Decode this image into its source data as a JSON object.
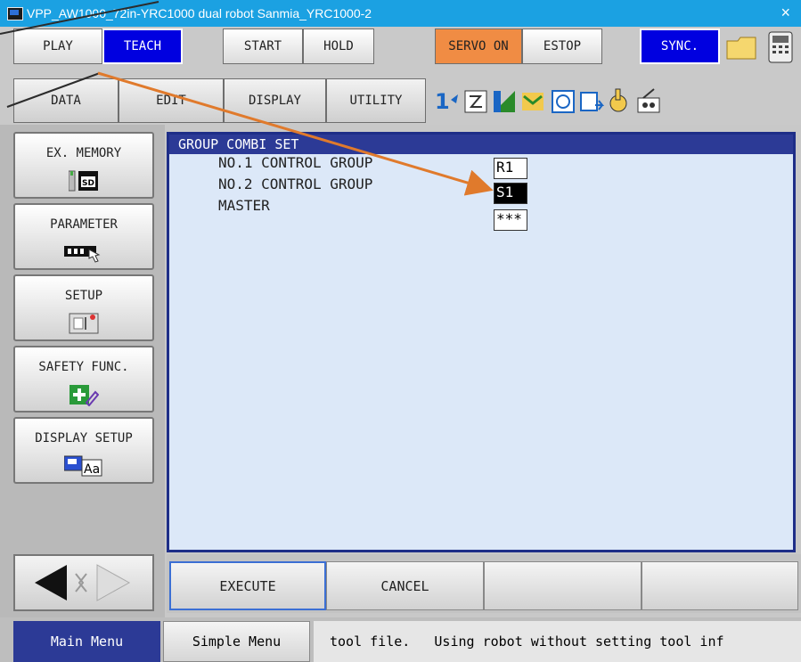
{
  "window": {
    "title": "VPP_AW1000_72in-YRC1000 dual robot Sanmia_YRC1000-2",
    "close": "×"
  },
  "top_buttons": {
    "play": "PLAY",
    "teach": "TEACH",
    "start": "START",
    "hold": "HOLD",
    "servo_on": "SERVO ON",
    "estop": "ESTOP",
    "sync": "SYNC."
  },
  "menu": {
    "data": "DATA",
    "edit": "EDIT",
    "display": "DISPLAY",
    "utility": "UTILITY"
  },
  "status_icons": [
    "coordinate-icon",
    "teach-lock-icon",
    "level-icon",
    "robot-icon",
    "job-icon",
    "output-icon",
    "hand-icon",
    "key-icon"
  ],
  "left_panel": {
    "items": [
      {
        "label": "EX. MEMORY",
        "icon": "sd-card-icon"
      },
      {
        "label": "PARAMETER",
        "icon": "parameter-icon"
      },
      {
        "label": "SETUP",
        "icon": "setup-icon"
      },
      {
        "label": "SAFETY FUNC.",
        "icon": "safety-icon"
      },
      {
        "label": "DISPLAY SETUP",
        "icon": "display-setup-icon"
      }
    ]
  },
  "content": {
    "title": "GROUP COMBI SET",
    "rows": [
      {
        "label": "NO.1 CONTROL GROUP",
        "value": "R1"
      },
      {
        "label": "NO.2 CONTROL GROUP",
        "value": "S1"
      },
      {
        "label": "MASTER",
        "value": "***"
      }
    ]
  },
  "actions": {
    "execute": "EXECUTE",
    "cancel": "CANCEL"
  },
  "bottom": {
    "main_menu": "Main Menu",
    "simple_menu": "Simple Menu",
    "message": "tool file.   Using robot without setting tool inf"
  },
  "colors": {
    "accent": "#1e2e88",
    "arrow": "#e07a2c",
    "servo": "#f08c44",
    "teach": "#0000e0"
  }
}
